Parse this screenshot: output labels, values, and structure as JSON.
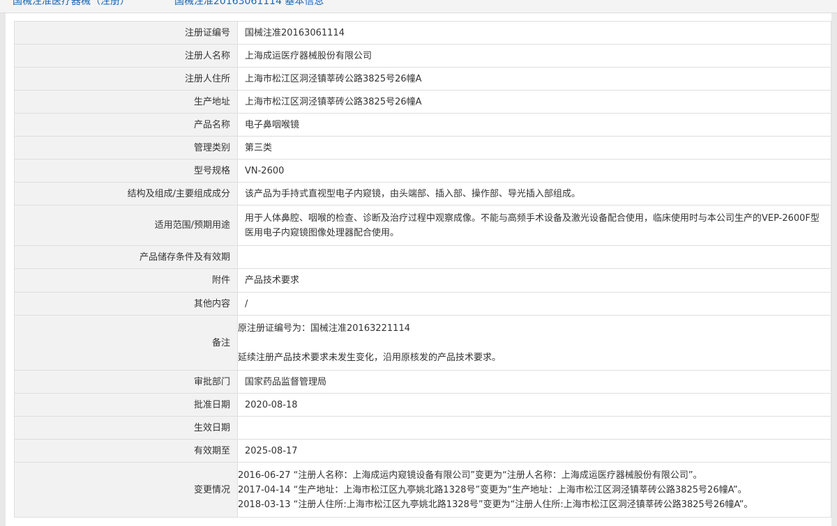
{
  "header": {
    "crumb1": "国械注准医疗器械（注册）",
    "crumb2": "国械注准20163061114   基本信息"
  },
  "rows": [
    {
      "label": "注册证编号",
      "value": "国械注准20163061114"
    },
    {
      "label": "注册人名称",
      "value": "上海成运医疗器械股份有限公司"
    },
    {
      "label": "注册人住所",
      "value": "上海市松江区洞泾镇莘砖公路3825号26幢A"
    },
    {
      "label": "生产地址",
      "value": "上海市松江区洞泾镇莘砖公路3825号26幢A"
    },
    {
      "label": "产品名称",
      "value": "电子鼻咽喉镜"
    },
    {
      "label": "管理类别",
      "value": "第三类"
    },
    {
      "label": "型号规格",
      "value": "VN-2600"
    },
    {
      "label": "结构及组成/主要组成成分",
      "value": "该产品为手持式直视型电子内窥镜，由头端部、插入部、操作部、导光插入部组成。"
    },
    {
      "label": "适用范围/预期用途",
      "value": "用于人体鼻腔、咽喉的检查、诊断及治疗过程中观察成像。不能与高频手术设备及激光设备配合使用，临床使用时与本公司生产的VEP-2600F型医用电子内窥镜图像处理器配合使用。"
    },
    {
      "label": "产品储存条件及有效期",
      "value": ""
    },
    {
      "label": "附件",
      "value": "产品技术要求"
    },
    {
      "label": "其他内容",
      "value": "/"
    },
    {
      "label": "备注",
      "line1": "原注册证编号为：国械注准20163221114",
      "line2": "延续注册产品技术要求未发生变化，沿用原核发的产品技术要求。"
    },
    {
      "label": "审批部门",
      "value": "国家药品监督管理局"
    },
    {
      "label": "批准日期",
      "value": "2020-08-18"
    },
    {
      "label": "生效日期",
      "value": ""
    },
    {
      "label": "有效期至",
      "value": "2025-08-17"
    },
    {
      "label": "变更情况",
      "changes": [
        "2016-06-27 “注册人名称：上海成运内窥镜设备有限公司”变更为“注册人名称：上海成运医疗器械股份有限公司”。",
        "2017-04-14 “生产地址：上海市松江区九亭姚北路1328号”变更为“生产地址：上海市松江区洞泾镇莘砖公路3825号26幢A”。",
        "2018-03-13 “注册人住所:上海市松江区九亭姚北路1328号”变更为“注册人住所:上海市松江区洞泾镇莘砖公路3825号26幢A”。"
      ]
    }
  ]
}
